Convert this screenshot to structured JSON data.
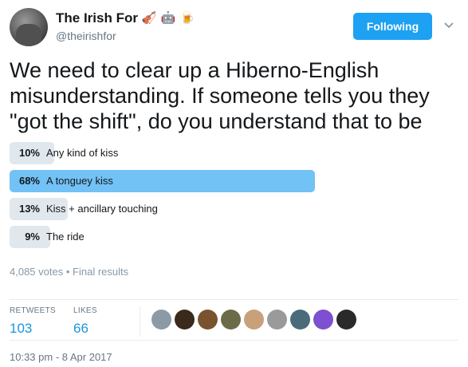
{
  "tweet": {
    "display_name": "The Irish For",
    "name_emojis": [
      {
        "icon": "violin-icon",
        "glyph": "🎻"
      },
      {
        "icon": "robot-icon",
        "glyph": "🤖"
      },
      {
        "icon": "beer-mug-icon",
        "glyph": "🍺"
      }
    ],
    "handle": "@theirishfor",
    "follow_label": "Following",
    "text": "We need to clear up a Hiberno-English misunderstanding. If someone tells you they \"got the shift\", do you understand that to be",
    "timestamp": "10:33 pm - 8 Apr 2017"
  },
  "poll": {
    "options": [
      {
        "percent": "10%",
        "label": "Any kind of kiss",
        "share": 0.1,
        "winner": false
      },
      {
        "percent": "68%",
        "label": "A tonguey kiss",
        "share": 0.68,
        "winner": true
      },
      {
        "percent": "13%",
        "label": "Kiss + ancillary touching",
        "share": 0.13,
        "winner": false
      },
      {
        "percent": "9%",
        "label": "The ride",
        "share": 0.09,
        "winner": false
      }
    ],
    "votes": "4,085 votes",
    "separator": "•",
    "status": "Final results"
  },
  "stats": {
    "retweets_label": "RETWEETS",
    "retweets_count": "103",
    "likes_label": "LIKES",
    "likes_count": "66",
    "liker_avatar_colors": [
      "#8a9aa6",
      "#3a2a1c",
      "#7a5230",
      "#6b6b4a",
      "#c8a07a",
      "#9a9a9a",
      "#4a6b7a",
      "#7d4fd1",
      "#2a2a2a"
    ]
  },
  "colors": {
    "accent": "#1da1f2",
    "winner_bar": "#72c2f6",
    "bar": "#e1e8ed"
  }
}
